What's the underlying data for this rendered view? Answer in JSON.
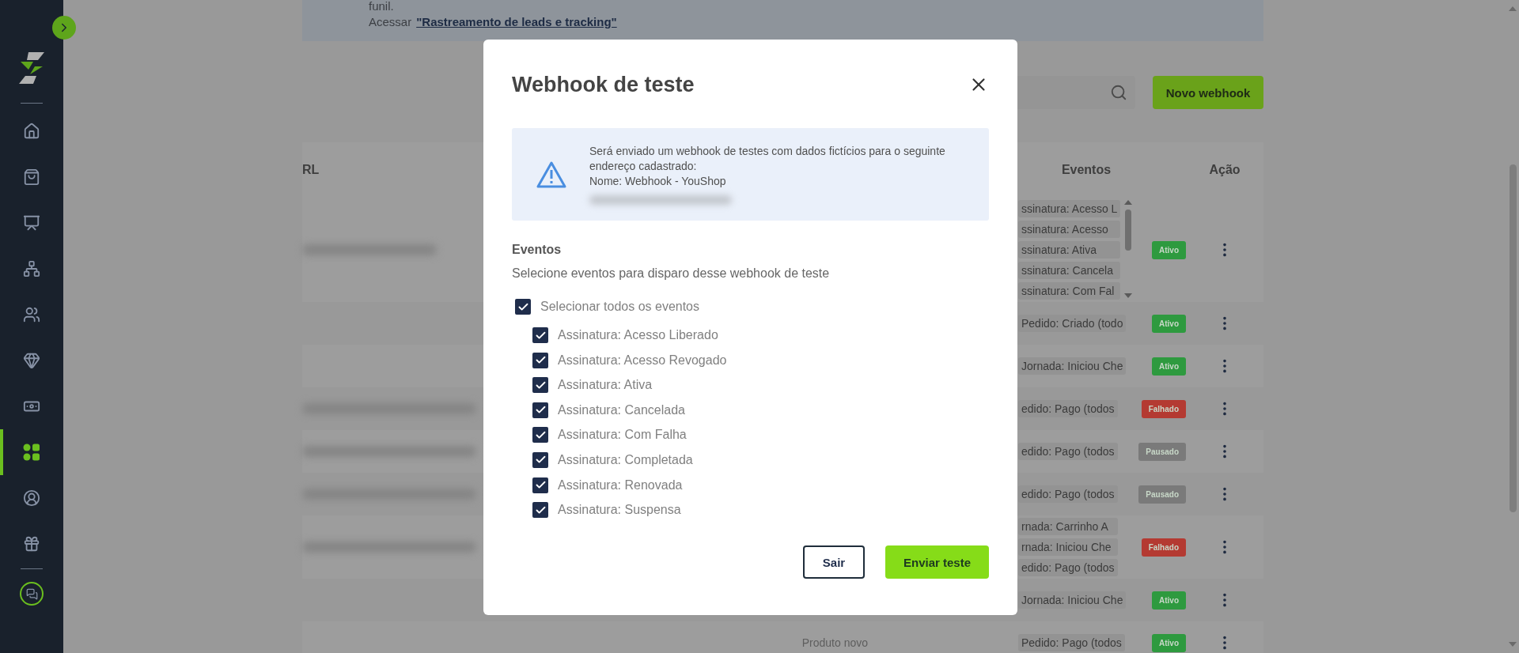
{
  "sidebar": {
    "items": [
      {
        "kind": "home",
        "selected": false
      },
      {
        "kind": "bag",
        "selected": false
      },
      {
        "kind": "board",
        "selected": false
      },
      {
        "kind": "network",
        "selected": false
      },
      {
        "kind": "team",
        "selected": false
      },
      {
        "kind": "gem",
        "selected": false
      },
      {
        "kind": "money",
        "selected": false
      },
      {
        "kind": "apps",
        "selected": true
      },
      {
        "kind": "user",
        "selected": false
      },
      {
        "kind": "gift",
        "selected": false
      }
    ]
  },
  "banner": {
    "partial_line": "funil.",
    "prefix": "Acessar",
    "link": "\"Rastreamento de leads e tracking\""
  },
  "toolbar": {
    "new_button": "Novo webhook"
  },
  "table": {
    "columns": [
      "RL",
      "Eventos",
      "Ação"
    ],
    "rows": [
      {
        "url_redacted": true,
        "events": [
          "ssinatura: Acesso L",
          "ssinatura: Acesso",
          "ssinatura: Ativa",
          "ssinatura: Cancela",
          "ssinatura: Com Fal"
        ],
        "status": {
          "label": "Ativo",
          "color": "#2e9a3f"
        }
      },
      {
        "url_redacted": false,
        "events": [
          "Pedido: Criado (todo"
        ],
        "status": {
          "label": "Ativo",
          "color": "#2e9a3f"
        }
      },
      {
        "url_redacted": false,
        "events": [
          "Jornada: Iniciou Che"
        ],
        "status": {
          "label": "Ativo",
          "color": "#2e9a3f"
        }
      },
      {
        "url_redacted": true,
        "events": [
          "edido: Pago (todos"
        ],
        "status": {
          "label": "Falhado",
          "color": "#b43a32"
        }
      },
      {
        "url_redacted": true,
        "events": [
          "edido: Pago (todos"
        ],
        "status": {
          "label": "Pausado",
          "color": "#7a7a7a"
        }
      },
      {
        "url_redacted": true,
        "events": [
          "edido: Pago (todos"
        ],
        "status": {
          "label": "Pausado",
          "color": "#7a7a7a"
        }
      },
      {
        "url_redacted": true,
        "events": [
          "rnada: Carrinho A",
          "rnada: Iniciou Che",
          "edido: Pago (todos"
        ],
        "status": {
          "label": "Falhado",
          "color": "#b43a32"
        }
      },
      {
        "url_redacted": false,
        "events": [
          "Jornada: Iniciou Che"
        ],
        "status": {
          "label": "Ativo",
          "color": "#2e9a3f"
        }
      },
      {
        "url_redacted": false,
        "product": "Produto novo",
        "events": [
          "Pedido: Pago (todos"
        ],
        "status": {
          "label": "Ativo",
          "color": "#2e9a3f"
        }
      }
    ]
  },
  "modal": {
    "title": "Webhook de teste",
    "info": "Será enviado um webhook de testes com dados fictícios para o seguinte endereço cadastrado:",
    "info_name": "Nome: Webhook - YouShop",
    "address_redacted": true,
    "section_title": "Eventos",
    "section_hint": "Selecione eventos para disparo desse webhook de teste",
    "select_all": {
      "label": "Selecionar todos os eventos",
      "checked": true
    },
    "events": [
      {
        "label": "Assinatura: Acesso Liberado",
        "checked": true
      },
      {
        "label": "Assinatura: Acesso Revogado",
        "checked": true
      },
      {
        "label": "Assinatura: Ativa",
        "checked": true
      },
      {
        "label": "Assinatura: Cancelada",
        "checked": true
      },
      {
        "label": "Assinatura: Com Falha",
        "checked": true
      },
      {
        "label": "Assinatura: Completada",
        "checked": true
      },
      {
        "label": "Assinatura: Renovada",
        "checked": true
      },
      {
        "label": "Assinatura: Suspensa",
        "checked": true
      }
    ],
    "cancel_button": "Sair",
    "submit_button": "Enviar teste"
  }
}
